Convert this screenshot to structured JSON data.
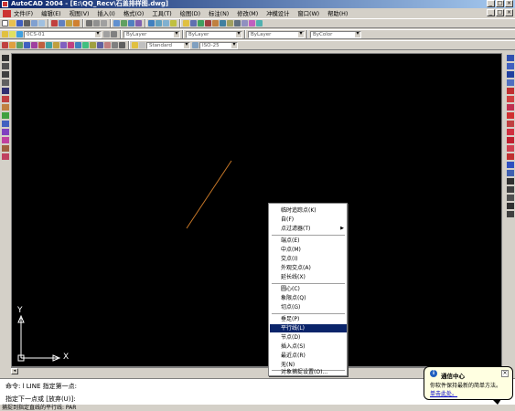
{
  "window": {
    "title": "AutoCAD 2004 - [E:\\QQ_Recv\\石盖排样图.dwg]",
    "controls": [
      "_",
      "□",
      "×"
    ]
  },
  "menubar": {
    "items": [
      "文件(F)",
      "编辑(E)",
      "视图(V)",
      "插入(I)",
      "格式(O)",
      "工具(T)",
      "绘图(D)",
      "标注(N)",
      "修改(M)",
      "冲模设计",
      "窗口(W)",
      "帮助(H)"
    ],
    "doc_controls": [
      "_",
      "□",
      "×"
    ]
  },
  "toolbars": {
    "layer_combo": "0CS-01",
    "color_combo": "ByLayer",
    "linetype_combo": "ByLayer",
    "lineweight_combo": "ByLayer",
    "plotstyle_combo": "ByColor",
    "textstyle_combo": "Standard",
    "dimstyle_combo": "ISO-25"
  },
  "ucs": {
    "x_label": "X",
    "y_label": "Y"
  },
  "context_menu": {
    "items": [
      {
        "label": "临时追踪点(K)",
        "highlight": false,
        "submenu": false
      },
      {
        "label": "自(F)",
        "highlight": false,
        "submenu": false
      },
      {
        "label": "点过滤器(T)",
        "highlight": false,
        "submenu": true
      },
      {
        "label": "端点(E)",
        "highlight": false,
        "submenu": false
      },
      {
        "label": "中点(M)",
        "highlight": false,
        "submenu": false
      },
      {
        "label": "交点(I)",
        "highlight": false,
        "submenu": false
      },
      {
        "label": "外观交点(A)",
        "highlight": false,
        "submenu": false
      },
      {
        "label": "延长线(X)",
        "highlight": false,
        "submenu": false
      },
      {
        "label": "圆心(C)",
        "highlight": false,
        "submenu": false
      },
      {
        "label": "象限点(Q)",
        "highlight": false,
        "submenu": false
      },
      {
        "label": "切点(G)",
        "highlight": false,
        "submenu": false
      },
      {
        "label": "垂足(P)",
        "highlight": false,
        "submenu": false
      },
      {
        "label": "平行线(L)",
        "highlight": true,
        "submenu": false
      },
      {
        "label": "节点(D)",
        "highlight": false,
        "submenu": false
      },
      {
        "label": "插入点(S)",
        "highlight": false,
        "submenu": false
      },
      {
        "label": "最近点(R)",
        "highlight": false,
        "submenu": false
      },
      {
        "label": "无(N)",
        "highlight": false,
        "submenu": false
      },
      {
        "label": "对象捕捉设置(O)...",
        "highlight": false,
        "submenu": false
      }
    ]
  },
  "command": {
    "line1": "命令: l LINE 指定第一点:",
    "line2": "指定下一点或 [放弃(U)]:"
  },
  "statusbar": {
    "text": "捕捉到指定直线的平行线: PAR"
  },
  "balloon": {
    "title": "通信中心",
    "body": "你软件保持最新的简单方法。",
    "link": "单击此处。",
    "icon": "info-icon"
  },
  "colors": {
    "drawing_bg": "#000000",
    "line": "#c87828",
    "highlight": "#0a246a",
    "balloon_bg": "#ffffe1"
  }
}
